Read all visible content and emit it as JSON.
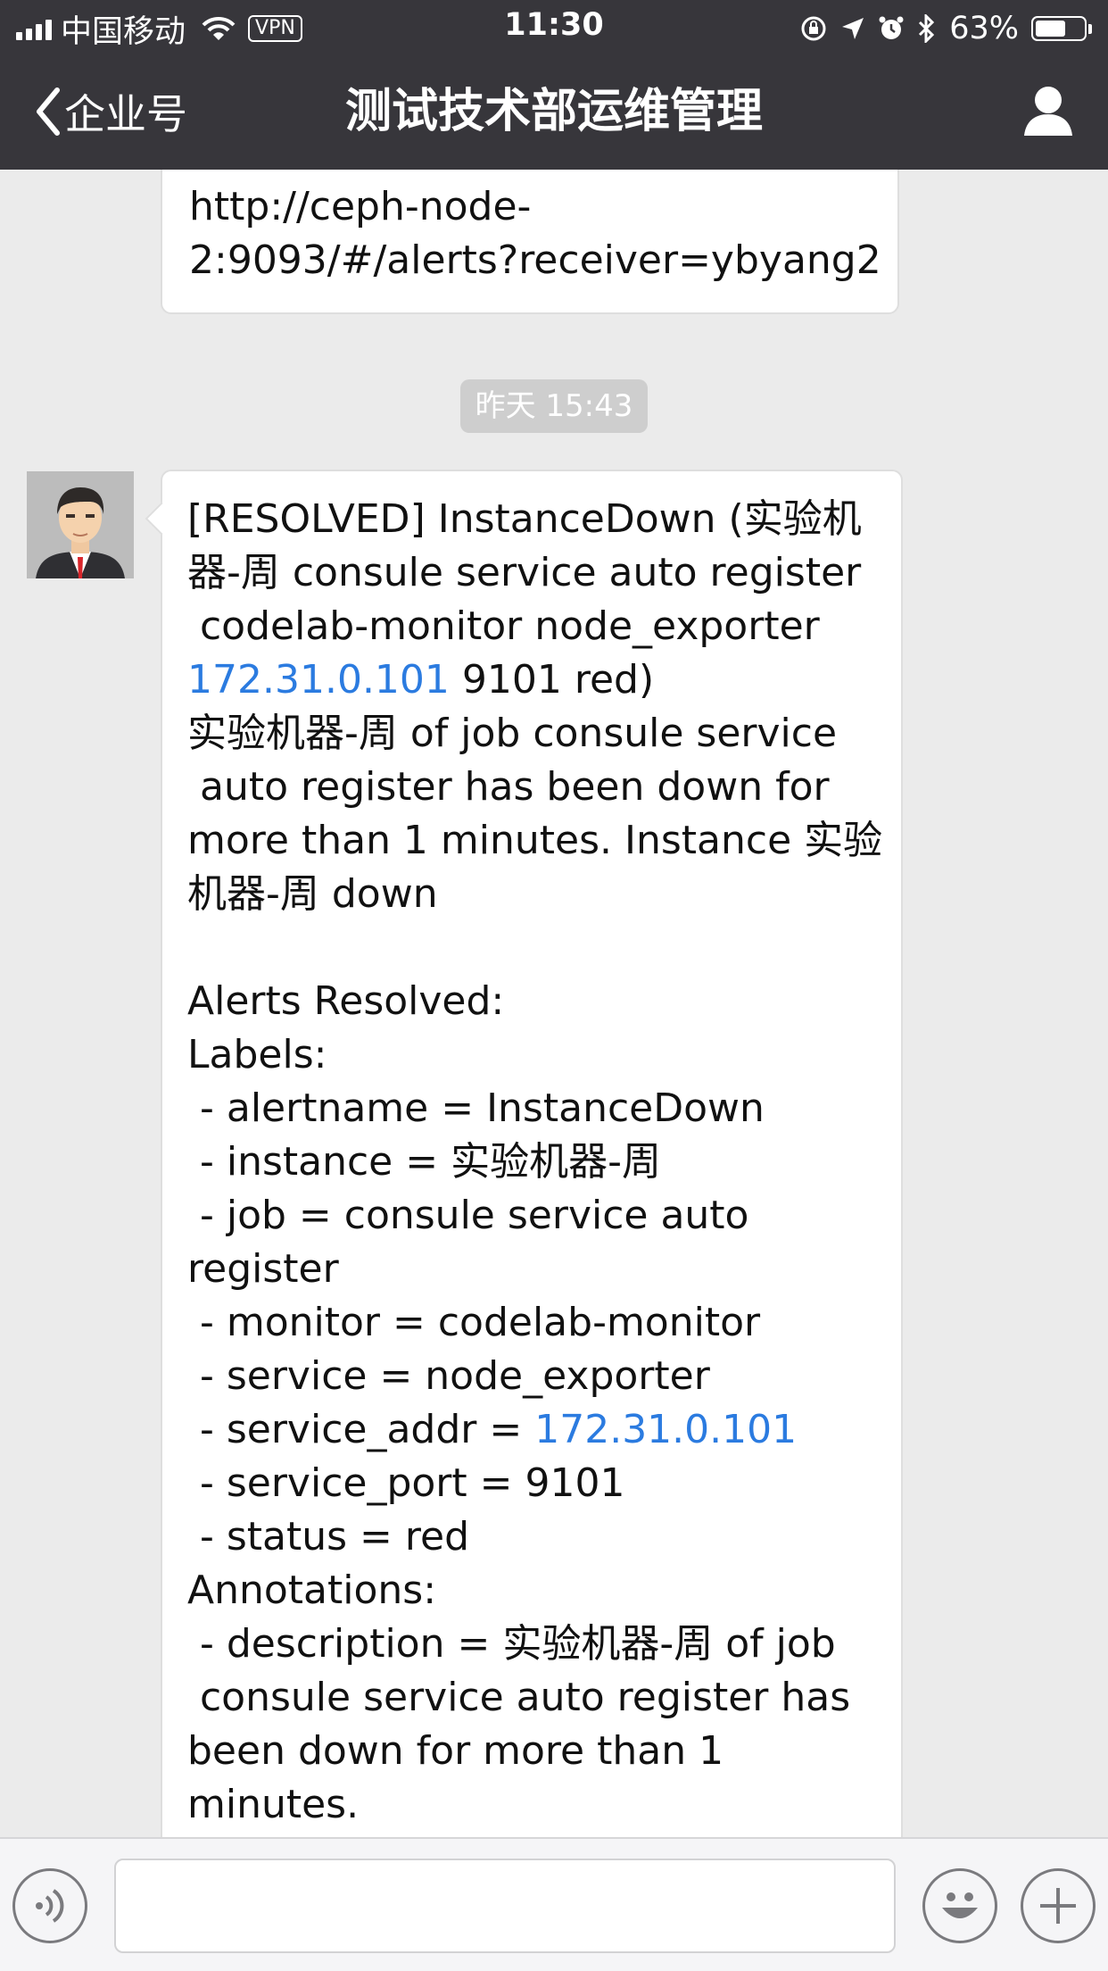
{
  "status_bar": {
    "carrier": "中国移动",
    "vpn": "VPN",
    "time": "11:30",
    "battery_percent": "63%",
    "battery_level": 0.63
  },
  "nav": {
    "back_label": "企业号",
    "title": "测试技术部运维管理"
  },
  "previous_message": {
    "lines": [
      "http://ceph-node-",
      "2:9093/#/alerts?receiver=ybyang2"
    ]
  },
  "timestamp": "昨天 15:43",
  "message": {
    "lines": [
      {
        "text": "[RESOLVED] InstanceDown (实验机"
      },
      {
        "text": "器-周 consule service auto register"
      },
      {
        "text": " codelab-monitor node_exporter"
      },
      {
        "link": "172.31.0.101",
        "rest": " 9101 red)"
      },
      {
        "text": "实验机器-周 of job consule service"
      },
      {
        "text": " auto register has been down for"
      },
      {
        "text": "more than 1 minutes. Instance 实验"
      },
      {
        "text": "机器-周 down"
      },
      {
        "text": ""
      },
      {
        "text": "Alerts Resolved:"
      },
      {
        "text": "Labels:"
      },
      {
        "text": " - alertname = InstanceDown"
      },
      {
        "text": " - instance = 实验机器-周"
      },
      {
        "text": " - job = consule service auto"
      },
      {
        "text": "register"
      },
      {
        "text": " - monitor = codelab-monitor"
      },
      {
        "text": " - service = node_exporter"
      },
      {
        "prefix": " - service_addr = ",
        "link": "172.31.0.101"
      },
      {
        "text": " - service_port = 9101"
      },
      {
        "text": " - status = red"
      },
      {
        "text": "Annotations:"
      },
      {
        "text": " - description = 实验机器-周 of job"
      },
      {
        "text": " consule service auto register has"
      },
      {
        "text": "been down for more than 1"
      },
      {
        "text": "minutes."
      }
    ]
  },
  "colors": {
    "header_bg": "#37363b",
    "chat_bg": "#ebebeb",
    "link": "#2b7be0"
  },
  "icons": [
    "signal-icon",
    "wifi-icon",
    "lock-rotation-icon",
    "location-arrow-icon",
    "alarm-icon",
    "bluetooth-icon",
    "battery-icon",
    "back-chevron-icon",
    "user-icon",
    "voice-icon",
    "emoji-icon",
    "plus-icon"
  ]
}
